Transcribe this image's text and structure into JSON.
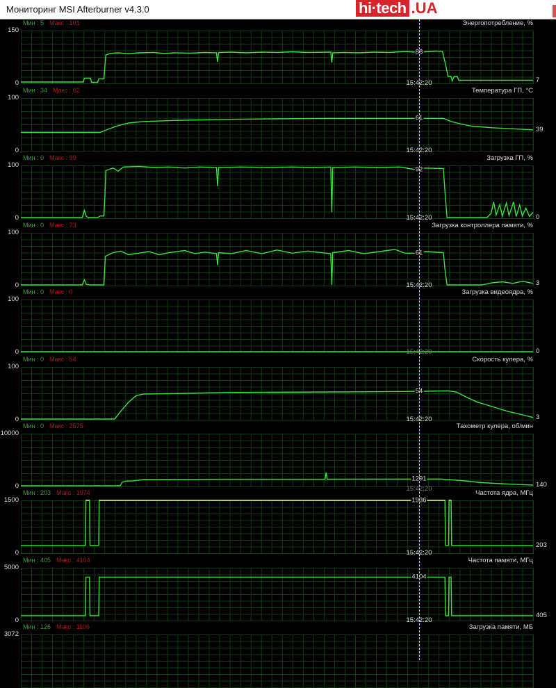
{
  "window": {
    "title": "Мониторинг MSI Afterburner v4.3.0"
  },
  "watermark": {
    "brand": "hi·tech",
    "suffix": ".UA"
  },
  "cursor": {
    "time": "15:42:20",
    "t": 77.2
  },
  "colors": {
    "line": "#3fe03f",
    "clipped": "#e8e070",
    "min": "#3b9a3b",
    "max": "#b01818"
  },
  "panels": [
    {
      "title": "Энергопотребление, %",
      "min_label": "Мин : 5",
      "max_label": "Макс : 101",
      "ymax": 150,
      "ymax_label": "150",
      "ymin_label": "0",
      "cursor_value": "88",
      "cursor_num": 88,
      "last_value": "7",
      "last_num": 7,
      "points": [
        [
          0,
          2
        ],
        [
          12.2,
          2
        ],
        [
          12.4,
          13
        ],
        [
          13.6,
          13
        ],
        [
          13.8,
          1
        ],
        [
          15.0,
          1
        ],
        [
          15.2,
          11
        ],
        [
          16.2,
          11
        ],
        [
          16.6,
          80
        ],
        [
          17.5,
          84
        ],
        [
          19,
          86
        ],
        [
          21,
          83
        ],
        [
          23,
          86
        ],
        [
          26,
          87
        ],
        [
          28,
          84
        ],
        [
          30,
          86
        ],
        [
          33,
          85
        ],
        [
          36,
          87
        ],
        [
          38.2,
          86
        ],
        [
          38.4,
          60
        ],
        [
          38.6,
          87
        ],
        [
          41,
          88
        ],
        [
          44,
          86
        ],
        [
          47,
          88
        ],
        [
          50,
          87
        ],
        [
          53,
          89
        ],
        [
          56,
          87
        ],
        [
          60.5,
          88
        ],
        [
          60.7,
          58
        ],
        [
          60.9,
          86
        ],
        [
          63,
          87
        ],
        [
          66,
          86
        ],
        [
          69,
          88
        ],
        [
          72,
          87
        ],
        [
          75,
          90
        ],
        [
          77,
          88
        ],
        [
          79,
          89
        ],
        [
          81,
          91
        ],
        [
          82.3,
          90
        ],
        [
          82.8,
          60
        ],
        [
          83.4,
          18
        ],
        [
          84.0,
          18
        ],
        [
          84.2,
          5
        ],
        [
          84.6,
          18
        ],
        [
          85.2,
          18
        ],
        [
          85.5,
          7
        ],
        [
          100,
          7
        ]
      ]
    },
    {
      "title": "Температура ГП, °C",
      "min_label": "Мин : 34",
      "max_label": "Макс : 62",
      "ymax": 100,
      "ymax_label": "100",
      "ymin_label": "0",
      "cursor_value": "61",
      "cursor_num": 61,
      "last_value": "39",
      "last_num": 39,
      "points": [
        [
          0,
          34
        ],
        [
          15.5,
          34
        ],
        [
          17,
          40
        ],
        [
          19,
          47
        ],
        [
          21,
          52
        ],
        [
          24,
          55
        ],
        [
          30,
          57
        ],
        [
          40,
          59
        ],
        [
          50,
          60
        ],
        [
          60,
          61
        ],
        [
          70,
          61
        ],
        [
          82.5,
          61
        ],
        [
          84,
          55
        ],
        [
          86,
          50
        ],
        [
          88,
          46
        ],
        [
          92,
          43
        ],
        [
          96,
          41
        ],
        [
          100,
          39
        ]
      ]
    },
    {
      "title": "Загрузка ГП, %",
      "min_label": "Мин : 0",
      "max_label": "Макс : 99",
      "ymax": 100,
      "ymax_label": "100",
      "ymin_label": "0",
      "cursor_value": "92",
      "cursor_num": 92,
      "last_value": "0",
      "last_num": 0,
      "points": [
        [
          0,
          0
        ],
        [
          12.0,
          0
        ],
        [
          12.4,
          14
        ],
        [
          12.8,
          2
        ],
        [
          13.2,
          0
        ],
        [
          15,
          0
        ],
        [
          15.5,
          3
        ],
        [
          16.2,
          3
        ],
        [
          16.4,
          40
        ],
        [
          16.6,
          90
        ],
        [
          18,
          95
        ],
        [
          19,
          89
        ],
        [
          20,
          97
        ],
        [
          23,
          98
        ],
        [
          26,
          96
        ],
        [
          29,
          97
        ],
        [
          32,
          95
        ],
        [
          35,
          97
        ],
        [
          38.2,
          96
        ],
        [
          38.4,
          60
        ],
        [
          38.6,
          96
        ],
        [
          43,
          97
        ],
        [
          48,
          96
        ],
        [
          53,
          97
        ],
        [
          57,
          96
        ],
        [
          60.5,
          97
        ],
        [
          60.7,
          10
        ],
        [
          60.9,
          96
        ],
        [
          65,
          97
        ],
        [
          70,
          96
        ],
        [
          74,
          97
        ],
        [
          77,
          92
        ],
        [
          79,
          95
        ],
        [
          82.5,
          94
        ],
        [
          82.8,
          50
        ],
        [
          83.2,
          0
        ],
        [
          91,
          0
        ],
        [
          91.8,
          8
        ],
        [
          92.3,
          30
        ],
        [
          92.8,
          5
        ],
        [
          93.5,
          25
        ],
        [
          94,
          3
        ],
        [
          94.8,
          28
        ],
        [
          95.3,
          4
        ],
        [
          96.2,
          30
        ],
        [
          96.7,
          2
        ],
        [
          97.4,
          24
        ],
        [
          97.9,
          3
        ],
        [
          98.6,
          18
        ],
        [
          99.3,
          2
        ],
        [
          100,
          10
        ]
      ]
    },
    {
      "title": "Загрузка контроллера памяти, %",
      "min_label": "Мин : 0",
      "max_label": "Макс : 73",
      "ymax": 100,
      "ymax_label": "100",
      "ymin_label": "0",
      "cursor_value": "61",
      "cursor_num": 61,
      "last_value": "3",
      "last_num": 3,
      "points": [
        [
          0,
          0
        ],
        [
          12.0,
          0
        ],
        [
          12.4,
          10
        ],
        [
          12.8,
          1
        ],
        [
          13.5,
          0
        ],
        [
          15,
          0
        ],
        [
          15.6,
          -2
        ],
        [
          16.2,
          -2
        ],
        [
          16.5,
          55
        ],
        [
          18,
          62
        ],
        [
          19.5,
          65
        ],
        [
          21,
          58
        ],
        [
          23,
          61
        ],
        [
          25,
          64
        ],
        [
          27,
          58
        ],
        [
          29,
          62
        ],
        [
          32,
          66
        ],
        [
          34,
          60
        ],
        [
          36,
          63
        ],
        [
          38.2,
          60
        ],
        [
          38.4,
          38
        ],
        [
          38.6,
          62
        ],
        [
          41,
          60
        ],
        [
          44,
          66
        ],
        [
          47,
          60
        ],
        [
          50,
          67
        ],
        [
          53,
          61
        ],
        [
          56,
          65
        ],
        [
          60.5,
          60
        ],
        [
          60.7,
          0
        ],
        [
          60.9,
          62
        ],
        [
          64,
          66
        ],
        [
          67,
          60
        ],
        [
          70,
          64
        ],
        [
          73,
          68
        ],
        [
          75,
          61
        ],
        [
          77,
          61
        ],
        [
          79,
          64
        ],
        [
          82.5,
          62
        ],
        [
          82.8,
          30
        ],
        [
          83.2,
          0
        ],
        [
          90,
          0
        ],
        [
          92,
          4
        ],
        [
          94,
          6
        ],
        [
          96,
          3
        ],
        [
          98,
          7
        ],
        [
          100,
          3
        ]
      ]
    },
    {
      "title": "Загрузка видеоядра, %",
      "min_label": "Мин : 0",
      "max_label": "Макс : 0",
      "ymax": 100,
      "ymax_label": "100",
      "ymin_label": "0",
      "cursor_value": "",
      "cursor_num": 0,
      "last_value": "0",
      "last_num": 0,
      "points": [
        [
          0,
          0
        ],
        [
          100,
          0
        ]
      ]
    },
    {
      "title": "Скорость кулера, %",
      "min_label": "Мин : 0",
      "max_label": "Макс : 54",
      "ymax": 100,
      "ymax_label": "100",
      "ymin_label": "0",
      "cursor_value": "54",
      "cursor_num": 54,
      "last_value": "3",
      "last_num": 3,
      "points": [
        [
          0,
          0
        ],
        [
          18.3,
          0
        ],
        [
          19.5,
          15
        ],
        [
          21,
          32
        ],
        [
          22.5,
          45
        ],
        [
          24,
          48
        ],
        [
          30,
          49
        ],
        [
          40,
          51
        ],
        [
          60,
          52
        ],
        [
          75,
          53
        ],
        [
          83.5,
          54
        ],
        [
          85,
          52
        ],
        [
          87,
          42
        ],
        [
          89,
          33
        ],
        [
          92,
          24
        ],
        [
          95,
          15
        ],
        [
          98,
          8
        ],
        [
          100,
          3
        ]
      ]
    },
    {
      "title": "Тахометр кулера, об/мин",
      "min_label": "Мин : 0",
      "max_label": "Макс : 2575",
      "ymax": 10000,
      "ymax_label": "10000",
      "ymin_label": "0",
      "cursor_value": "1291",
      "cursor_num": 1291,
      "last_value": "140",
      "last_num": 140,
      "points": [
        [
          0,
          0
        ],
        [
          19.4,
          0
        ],
        [
          19.8,
          700
        ],
        [
          20.6,
          900
        ],
        [
          22,
          950
        ],
        [
          24,
          1200
        ],
        [
          40,
          1250
        ],
        [
          59.4,
          1270
        ],
        [
          59.6,
          2575
        ],
        [
          59.8,
          1270
        ],
        [
          82,
          1291
        ],
        [
          86,
          1000
        ],
        [
          90,
          600
        ],
        [
          95,
          350
        ],
        [
          100,
          140
        ]
      ]
    },
    {
      "title": "Частота ядра, МГц",
      "min_label": "Мин : 203",
      "max_label": "Макс : 1974",
      "ymax": 1500,
      "ymax_label": "1500",
      "ymin_label": "0",
      "cursor_value": "1936",
      "cursor_num": 1936,
      "last_value": "203",
      "last_num": 203,
      "points": [
        [
          0,
          203
        ],
        [
          12.6,
          203
        ],
        [
          12.7,
          1974
        ],
        [
          13.4,
          1974
        ],
        [
          13.5,
          203
        ],
        [
          15.2,
          203
        ],
        [
          15.3,
          1974
        ],
        [
          82.8,
          1936
        ],
        [
          82.9,
          203
        ],
        [
          83.5,
          203
        ],
        [
          83.6,
          1974
        ],
        [
          84.0,
          1974
        ],
        [
          84.1,
          203
        ],
        [
          100,
          203
        ]
      ]
    },
    {
      "title": "Частота памяти, МГц",
      "min_label": "Мин : 405",
      "max_label": "Макс : 4104",
      "ymax": 5000,
      "ymax_label": "5000",
      "ymin_label": "0",
      "cursor_value": "4104",
      "cursor_num": 4104,
      "last_value": "405",
      "last_num": 405,
      "points": [
        [
          0,
          405
        ],
        [
          12.6,
          405
        ],
        [
          12.7,
          4104
        ],
        [
          13.4,
          4104
        ],
        [
          13.5,
          405
        ],
        [
          15.2,
          405
        ],
        [
          15.3,
          4104
        ],
        [
          82.8,
          4104
        ],
        [
          82.9,
          405
        ],
        [
          83.5,
          405
        ],
        [
          83.6,
          4104
        ],
        [
          84.0,
          4104
        ],
        [
          84.1,
          405
        ],
        [
          100,
          405
        ]
      ]
    },
    {
      "title": "Загрузка памяти, МБ",
      "min_label": "Мин : 126",
      "max_label": "Макс : 1106",
      "ymax": 3072,
      "ymax_label": "3072",
      "ymin_label": "",
      "cursor_value": "",
      "cursor_num": 0,
      "last_value": "",
      "last_num": 0,
      "points": []
    }
  ]
}
